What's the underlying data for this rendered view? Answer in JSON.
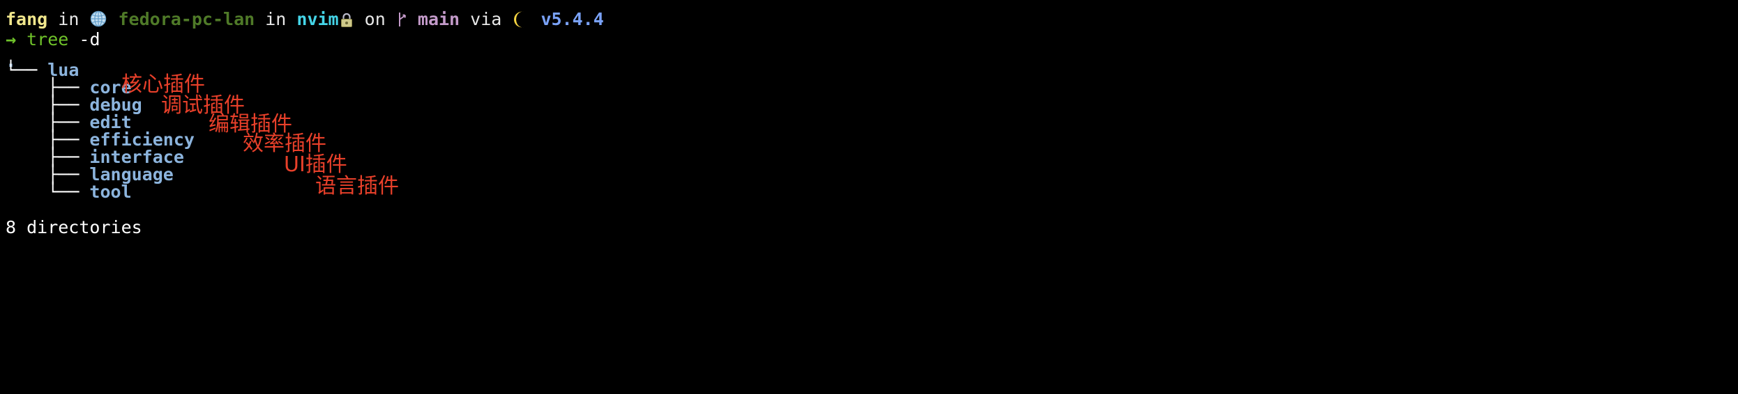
{
  "terminal": {
    "background_color": "#000000",
    "prompt": {
      "user": "fang",
      "in_1": " in ",
      "globe_icon": "globe-icon",
      "host": "fedora-pc-lan",
      "in_2": " in ",
      "directory": "nvim",
      "lock_icon": "lock-icon",
      "on": " on ",
      "branch_icon": "git-branch-icon",
      "branch": "main",
      "via": " via ",
      "moon_icon": "moon-icon",
      "version": "v5.4.4"
    },
    "command_line": {
      "prompt_symbol": "→",
      "command": "tree",
      "args": "-d"
    },
    "tree": {
      "root": ".",
      "root_connector": "└── ",
      "root_label": "lua",
      "children": [
        {
          "connector": "    ├── ",
          "label": "core"
        },
        {
          "connector": "    ├── ",
          "label": "debug"
        },
        {
          "connector": "    ├── ",
          "label": "edit"
        },
        {
          "connector": "    ├── ",
          "label": "efficiency"
        },
        {
          "connector": "    ├── ",
          "label": "interface"
        },
        {
          "connector": "    ├── ",
          "label": "language"
        },
        {
          "connector": "    └── ",
          "label": "tool"
        }
      ]
    },
    "summary": "8 directories",
    "annotations": [
      {
        "text": "核心插件",
        "color": "#e8402a"
      },
      {
        "text": "调试插件",
        "color": "#e8402a"
      },
      {
        "text": "编辑插件",
        "color": "#e8402a"
      },
      {
        "text": "效率插件",
        "color": "#e8402a"
      },
      {
        "text": "UI插件",
        "color": "#e8402a"
      },
      {
        "text": "语言插件",
        "color": "#e8402a"
      }
    ]
  }
}
